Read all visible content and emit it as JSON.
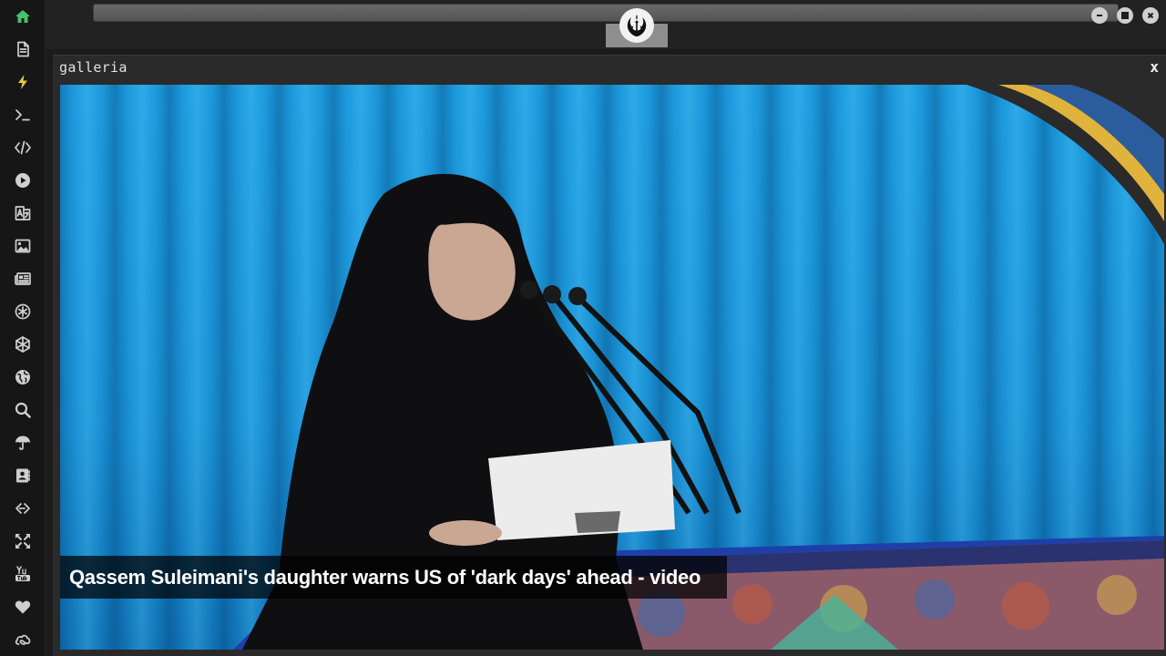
{
  "app": {
    "window_controls": [
      "minimize",
      "maximize",
      "close"
    ]
  },
  "sidebar": {
    "items": [
      {
        "icon": "home-icon",
        "active": true
      },
      {
        "icon": "document-icon"
      },
      {
        "icon": "lightning-icon"
      },
      {
        "icon": "terminal-icon"
      },
      {
        "icon": "code-icon"
      },
      {
        "icon": "play-icon"
      },
      {
        "icon": "translate-icon"
      },
      {
        "icon": "image-icon"
      },
      {
        "icon": "newspaper-icon"
      },
      {
        "icon": "asterisk-icon"
      },
      {
        "icon": "network-icon"
      },
      {
        "icon": "globe-icon"
      },
      {
        "icon": "search-icon"
      },
      {
        "icon": "umbrella-icon"
      },
      {
        "icon": "contact-icon"
      },
      {
        "icon": "link-icon"
      },
      {
        "icon": "expand-icon"
      },
      {
        "icon": "youtube-icon"
      },
      {
        "icon": "heart-icon"
      },
      {
        "icon": "cloud-icon"
      }
    ]
  },
  "panel": {
    "title": "galleria",
    "close_label": "x"
  },
  "gallery": {
    "caption": "Qassem Suleimani's daughter warns US of 'dark days' ahead - video"
  },
  "colors": {
    "sidebar_bg": "#161616",
    "active_icon": "#43c36b",
    "accent_icon": "#e7c84a",
    "photo_background": "#1d9fe3"
  }
}
